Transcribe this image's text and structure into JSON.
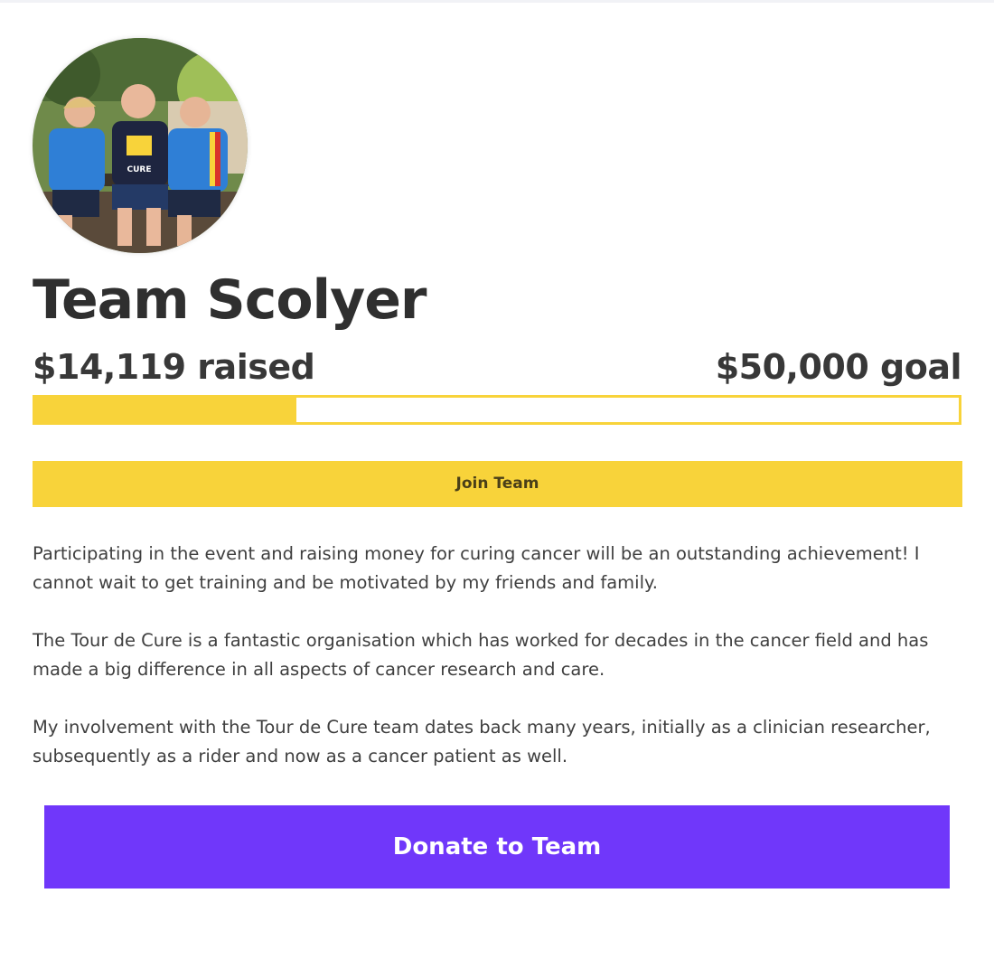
{
  "team": {
    "name": "Team Scolyer",
    "avatar_icon": "team-photo"
  },
  "fundraising": {
    "raised_label": "$14,119 raised",
    "goal_label": "$50,000 goal",
    "raised_amount": 14119,
    "goal_amount": 50000,
    "progress_fraction": 0.2824
  },
  "actions": {
    "join_label": "Join Team",
    "donate_label": "Donate to Team"
  },
  "story": {
    "paragraphs": [
      "Participating in the event and raising money for curing cancer will be an outstanding achievement! I cannot wait to get training and be motivated by my friends and family.",
      "The Tour de Cure is a fantastic organisation which has worked for decades in the cancer field and has made a big difference in all aspects of cancer research and care.",
      "My involvement with the Tour de Cure team dates back many years, initially as a clinician researcher, subsequently as a rider and now as a cancer patient as well."
    ]
  },
  "colors": {
    "accent_yellow": "#f8d33a",
    "donate_purple": "#7037fa",
    "text_dark": "#2f2f2f"
  }
}
